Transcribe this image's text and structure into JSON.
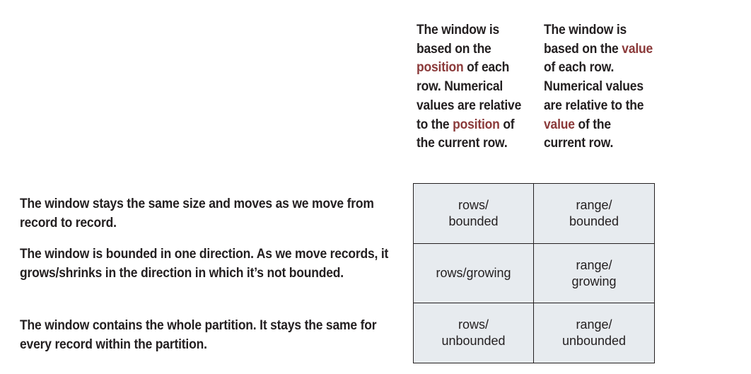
{
  "columns": {
    "rows": {
      "p1": "The window is based on the ",
      "h1": "position",
      "p2": " of each row. Numerical values are relative to the ",
      "h2": "position",
      "p3": " of the current row."
    },
    "range": {
      "p1": "The window is based on the ",
      "h1": "value",
      "p2": " of each row. Numerical values are relative to the ",
      "h2": "value",
      "p3": " of the current row."
    }
  },
  "row_descriptions": {
    "bounded": "The window stays the same size and moves as we move from record to record.",
    "growing": "The window is bounded in one direction. As we move records, it grows/shrinks in the direction in which it’s not bounded.",
    "unbounded": "The window contains the whole partition. It stays the same for every record within the partition."
  },
  "cells": {
    "rows_bounded": "rows/\nbounded",
    "range_bounded": "range/\nbounded",
    "rows_growing": "rows/growing",
    "range_growing": "range/\ngrowing",
    "rows_unbounded": "rows/\nunbounded",
    "range_unbounded": "range/\nunbounded"
  },
  "colors": {
    "text": "#231f20",
    "highlight": "#8b3a3a",
    "cell_background": "#e7ebef",
    "border": "#231f20"
  }
}
